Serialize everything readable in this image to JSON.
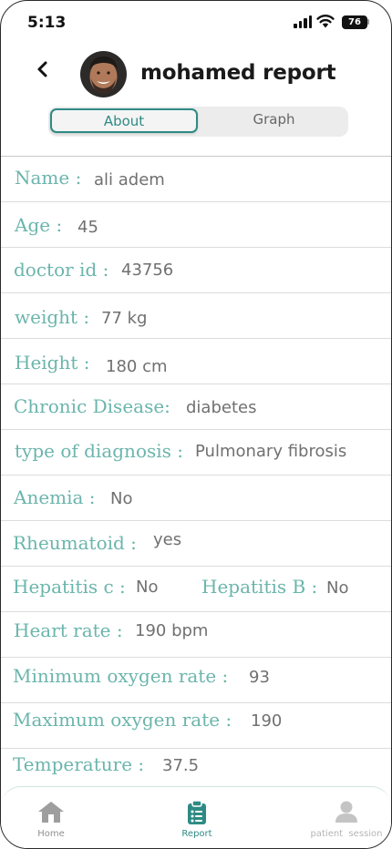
{
  "status_bar": {
    "time": "5:13",
    "battery": "76"
  },
  "header": {
    "title": "mohamed report"
  },
  "tabs": [
    {
      "label": "About",
      "active": true
    },
    {
      "label": "Graph",
      "active": false
    }
  ],
  "fields": {
    "name": {
      "label": "Name :",
      "value": "ali adem"
    },
    "age": {
      "label": "Age :",
      "value": "45"
    },
    "doctor_id": {
      "label": "doctor id :",
      "value": "43756"
    },
    "weight": {
      "label": "weight :",
      "value": "77 kg"
    },
    "height": {
      "label": "Height :",
      "value": "180 cm"
    },
    "chronic_disease": {
      "label": "Chronic Disease:",
      "value": "diabetes"
    },
    "diagnosis": {
      "label": "type of diagnosis :",
      "value": "Pulmonary fibrosis"
    },
    "anemia": {
      "label": "Anemia :",
      "value": "No"
    },
    "rheumatoid": {
      "label": "Rheumatoid :",
      "value": "yes"
    },
    "hepatitis_c": {
      "label": "Hepatitis c :",
      "value": "No"
    },
    "hepatitis_b": {
      "label": "Hepatitis B :",
      "value": "No"
    },
    "heart_rate": {
      "label": "Heart rate :",
      "value": "190 bpm"
    },
    "min_oxygen": {
      "label": "Minimum oxygen rate :",
      "value": "93"
    },
    "max_oxygen": {
      "label": "Maximum oxygen rate :",
      "value": "190"
    },
    "temperature": {
      "label": "Temperature :",
      "value": "37.5"
    }
  },
  "bottom_nav": [
    {
      "label": "Home",
      "icon": "home-icon",
      "active": false
    },
    {
      "label": "Report",
      "icon": "clipboard-icon",
      "active": true
    },
    {
      "label": "patient  session",
      "icon": "person-icon",
      "active": false
    }
  ],
  "colors": {
    "accent": "#2e8b84",
    "label": "#6bb5ac",
    "value": "#707070",
    "inactive": "#999999"
  }
}
